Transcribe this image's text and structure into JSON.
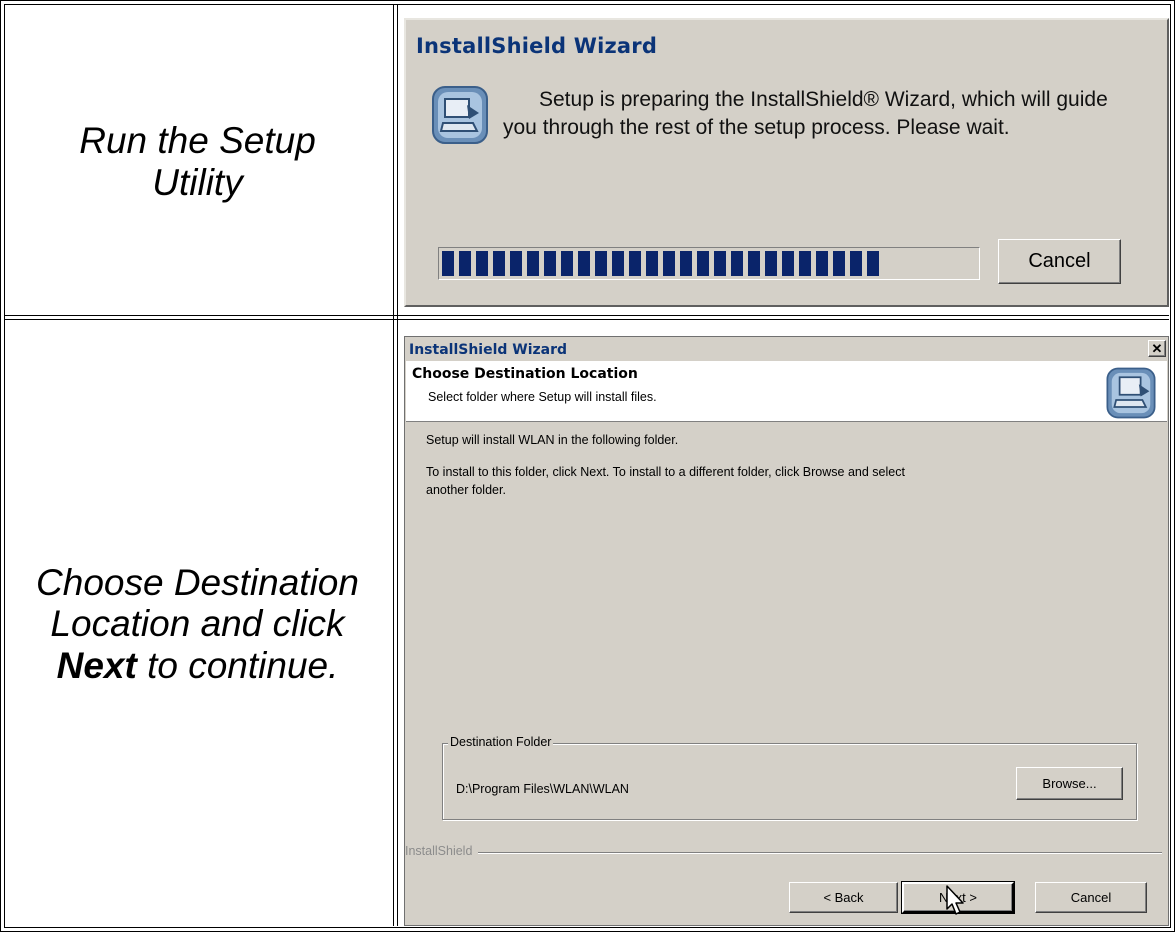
{
  "rows": [
    {
      "caption_plain": "Run the Setup Utility",
      "dialog": {
        "title": "InstallShield Wizard",
        "message_line1": "Setup is preparing the InstallShield® Wizard, which will guide",
        "message_line2": "you through the rest of the setup process. Please wait.",
        "progress": 0.85,
        "cancel_label": "Cancel"
      }
    },
    {
      "caption_line1": "Choose Destination",
      "caption_line2": "Location and click",
      "caption_bold": "Next",
      "caption_tail": " to continue.",
      "dialog": {
        "title": "InstallShield Wizard",
        "close_label": "✕",
        "header_title": "Choose Destination Location",
        "header_subtitle": "Select folder where Setup will install files.",
        "body_line1": "Setup will install WLAN in the following folder.",
        "body_line2": "To install to this folder, click Next. To install to a different folder, click Browse and select",
        "body_line3": "another folder.",
        "group_label": "Destination Folder",
        "folder_path": "D:\\Program Files\\WLAN\\WLAN",
        "browse_label": "Browse...",
        "brand_label": "InstallShield",
        "back_label": "< Back",
        "next_label": "Next >",
        "cancel_label": "Cancel"
      }
    }
  ],
  "icons": [
    "installer-icon",
    "close-icon",
    "mouse-cursor-icon"
  ],
  "colors": {
    "dialog_bg": "#d4d0c8",
    "title_blue": "#0b3478",
    "progress_fill": "#0a246a"
  }
}
